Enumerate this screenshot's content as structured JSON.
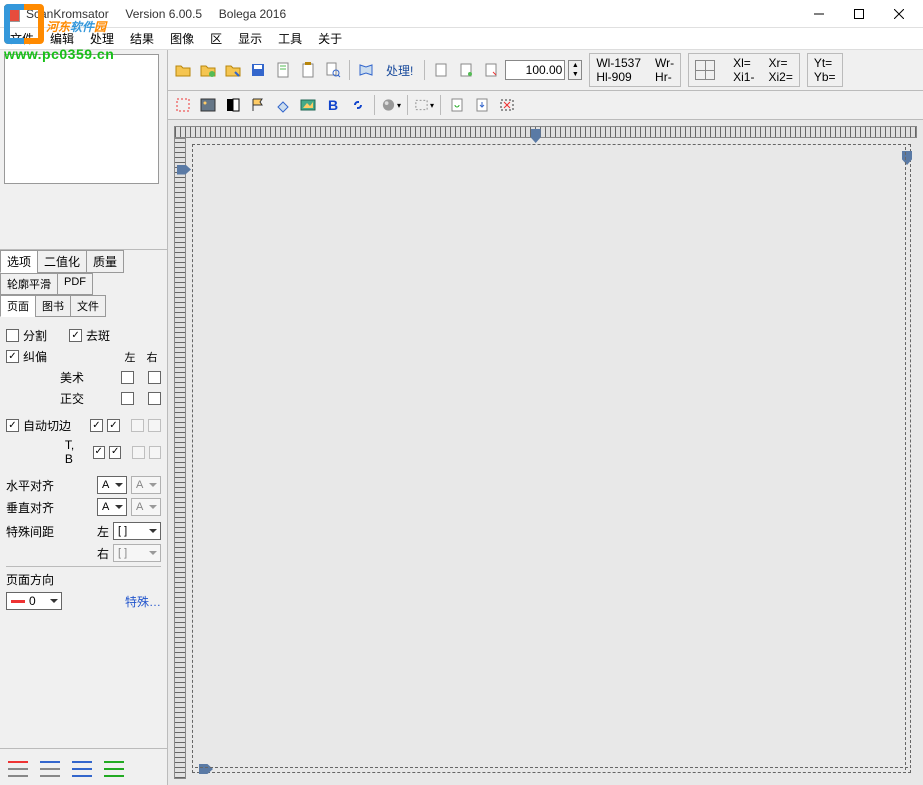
{
  "watermark": {
    "text": "河东软件园",
    "url": "www.pc0359.cn"
  },
  "title": "ScanKromsator     Version 6.00.5     Bolega 2016",
  "winctrl": {
    "min": "minimize",
    "max": "maximize",
    "close": "close"
  },
  "menu": [
    "文件",
    "编辑",
    "处理",
    "结果",
    "图像",
    "区",
    "显示",
    "工具",
    "关于"
  ],
  "toolbar1": {
    "process": "处理!",
    "zoom_value": "100.00",
    "info": {
      "Wl": "Wl-1537",
      "Hl": "Hl-909",
      "Wr": "Wr-",
      "Hr": "Hr-",
      "Xl": "Xl=",
      "Xi1": "Xi1-",
      "Xr": "Xr=",
      "Xi2": "Xi2=",
      "Yt": "Yt=",
      "Yb": "Yb="
    }
  },
  "sidepanel": {
    "tabs1": [
      "选项",
      "二值化",
      "质量"
    ],
    "tabs2": [
      "轮廓平滑",
      "PDF"
    ],
    "tabs3": [
      "页面",
      "图书",
      "文件"
    ],
    "split": "分割",
    "despeckle": "去斑",
    "deskew": "纠偏",
    "left": "左",
    "right": "右",
    "art": "美术",
    "ortho": "正交",
    "autocrop": "自动切边",
    "tb": "T, B",
    "halign": "水平对齐",
    "valign": "垂直对齐",
    "align_val": "A",
    "spacing": "特殊间距",
    "sp_left": "左",
    "sp_right": "右",
    "sp_val": "[ ]",
    "orient": "页面方向",
    "orient_val": "0",
    "special": "特殊…"
  }
}
